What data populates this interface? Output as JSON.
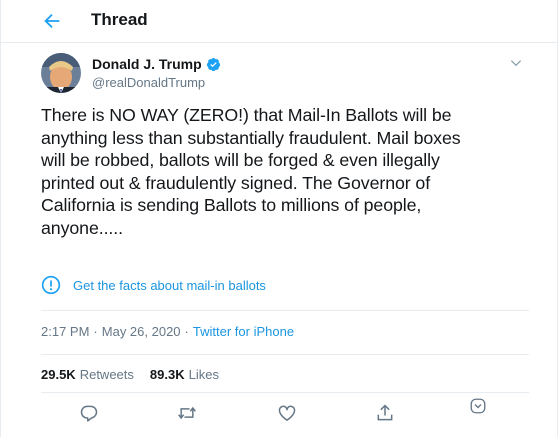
{
  "header": {
    "title": "Thread",
    "back_icon": "back-arrow-icon"
  },
  "tweet": {
    "author_name": "Donald J. Trump",
    "author_handle": "@realDonaldTrump",
    "verified_icon": "verified-badge-icon",
    "text_lines": [
      "There is NO WAY (ZERO!) that Mail-In Ballots will be",
      "anything less than substantially fraudulent. Mail boxes",
      "will be robbed, ballots will be forged & even illegally",
      "printed out & fraudulently signed. The Governor of",
      "California is sending Ballots to millions of people,",
      "anyone....."
    ],
    "facts_link": "Get the facts about mail-in ballots",
    "time": "2:17 PM",
    "date": "May 26, 2020",
    "separator": "·",
    "source": "Twitter for iPhone",
    "retweets_count": "29.5K",
    "retweets_label": "Retweets",
    "likes_count": "89.3K",
    "likes_label": "Likes"
  },
  "actions": [
    "reply-icon",
    "retweet-icon",
    "like-icon",
    "share-icon",
    "analytics-icon"
  ],
  "colors": {
    "accent": "#1b95e0",
    "text": "#14171a",
    "secondary": "#657786",
    "border": "#e6ecf0",
    "verified": "#1da1f2"
  }
}
